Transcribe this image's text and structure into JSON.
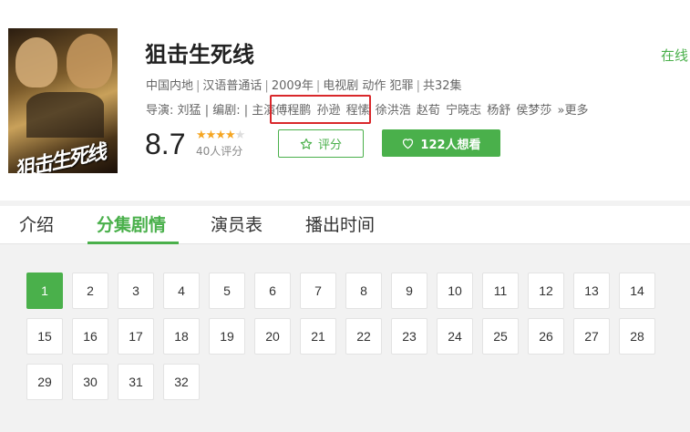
{
  "show": {
    "title": "狙击生死线",
    "online_label": "在线",
    "poster_title": "狙击生死线",
    "meta": [
      "中国内地",
      "汉语普通话",
      "2009年",
      "电视剧 动作 犯罪",
      "共32集"
    ],
    "director_label": "导演:",
    "director": "刘猛",
    "writer_label": "编剧:",
    "cast_label": "主演",
    "cast": [
      "傅程鹏",
      "孙逊",
      "程愫",
      "徐洪浩",
      "赵荀",
      "宁晓志",
      "杨舒",
      "侯梦莎"
    ],
    "more_label": "»更多",
    "score": "8.7",
    "stars": "★★★★",
    "star_half": "★",
    "votes": "40人评分",
    "rate_button": "评分",
    "want_button": "122人想看"
  },
  "tabs": [
    "介绍",
    "分集剧情",
    "演员表",
    "播出时间"
  ],
  "active_tab": "分集剧情",
  "episodes": [
    "1",
    "2",
    "3",
    "4",
    "5",
    "6",
    "7",
    "8",
    "9",
    "10",
    "11",
    "12",
    "13",
    "14",
    "15",
    "16",
    "17",
    "18",
    "19",
    "20",
    "21",
    "22",
    "23",
    "24",
    "25",
    "26",
    "27",
    "28",
    "29",
    "30",
    "31",
    "32"
  ],
  "active_episode": "1",
  "colors": {
    "accent": "#4ab04b",
    "highlight": "#d9282b",
    "star": "#f5a623"
  }
}
